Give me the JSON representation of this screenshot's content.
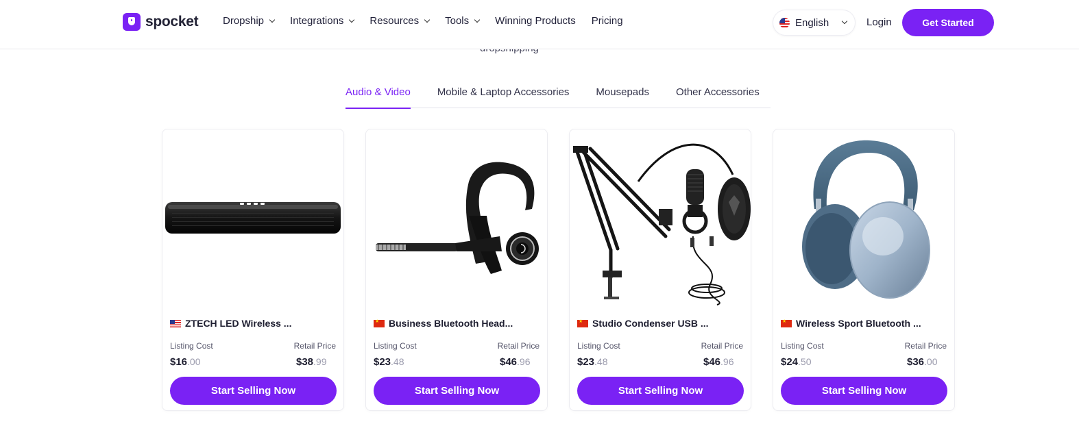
{
  "header": {
    "logo_text": "spocket",
    "nav": [
      {
        "label": "Dropship",
        "has_dropdown": true
      },
      {
        "label": "Integrations",
        "has_dropdown": true
      },
      {
        "label": "Resources",
        "has_dropdown": true
      },
      {
        "label": "Tools",
        "has_dropdown": true
      },
      {
        "label": "Winning Products",
        "has_dropdown": false
      },
      {
        "label": "Pricing",
        "has_dropdown": false
      }
    ],
    "language": "English",
    "login": "Login",
    "cta": "Get Started"
  },
  "clipped_subtitle": "dropshipping",
  "tabs": [
    {
      "label": "Audio & Video",
      "active": true
    },
    {
      "label": "Mobile & Laptop Accessories",
      "active": false
    },
    {
      "label": "Mousepads",
      "active": false
    },
    {
      "label": "Other Accessories",
      "active": false
    }
  ],
  "products": [
    {
      "title": "ZTECH LED Wireless ...",
      "origin_flag": "us-flag-icon",
      "listing_label": "Listing Cost",
      "retail_label": "Retail Price",
      "listing_whole": "$16",
      "listing_cents": ".00",
      "retail_whole": "$38",
      "retail_cents": ".99",
      "button": "Start Selling Now"
    },
    {
      "title": "Business Bluetooth Head...",
      "origin_flag": "cn-flag-icon",
      "listing_label": "Listing Cost",
      "retail_label": "Retail Price",
      "listing_whole": "$23",
      "listing_cents": ".48",
      "retail_whole": "$46",
      "retail_cents": ".96",
      "button": "Start Selling Now"
    },
    {
      "title": "Studio Condenser USB ...",
      "origin_flag": "cn-flag-icon",
      "listing_label": "Listing Cost",
      "retail_label": "Retail Price",
      "listing_whole": "$23",
      "listing_cents": ".48",
      "retail_whole": "$46",
      "retail_cents": ".96",
      "button": "Start Selling Now"
    },
    {
      "title": "Wireless Sport Bluetooth ...",
      "origin_flag": "cn-flag-icon",
      "listing_label": "Listing Cost",
      "retail_label": "Retail Price",
      "listing_whole": "$24",
      "listing_cents": ".50",
      "retail_whole": "$36",
      "retail_cents": ".00",
      "button": "Start Selling Now"
    }
  ],
  "colors": {
    "accent": "#7a22f4",
    "text": "#1e1e30",
    "muted": "#9a9aac"
  }
}
